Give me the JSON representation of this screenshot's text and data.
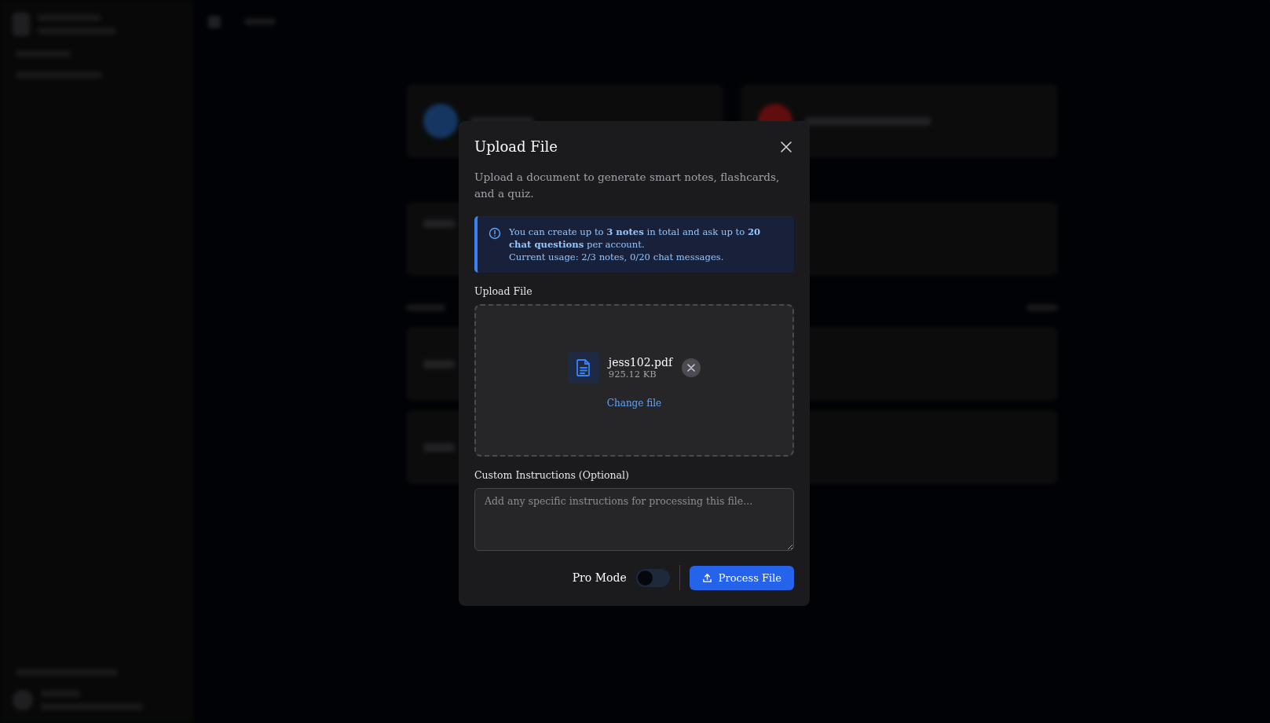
{
  "dialog": {
    "title": "Upload File",
    "description": "Upload a document to generate smart notes, flashcards, and a quiz.",
    "notice": {
      "lines": [
        "You can create up to **3 notes** in total and ask up to **20 chat questions** per account.",
        "Current usage: 2/3 notes, 0/20 chat messages."
      ]
    },
    "upload": {
      "label": "Upload File",
      "file": {
        "name": "jess102.pdf",
        "size": "925.12 KB"
      },
      "change_link": "Change file"
    },
    "instructions": {
      "label": "Custom Instructions (Optional)",
      "placeholder": "Add any specific instructions for processing this file..."
    },
    "pro_mode": {
      "label": "Pro Mode",
      "on": false
    },
    "submit": "Process File"
  }
}
